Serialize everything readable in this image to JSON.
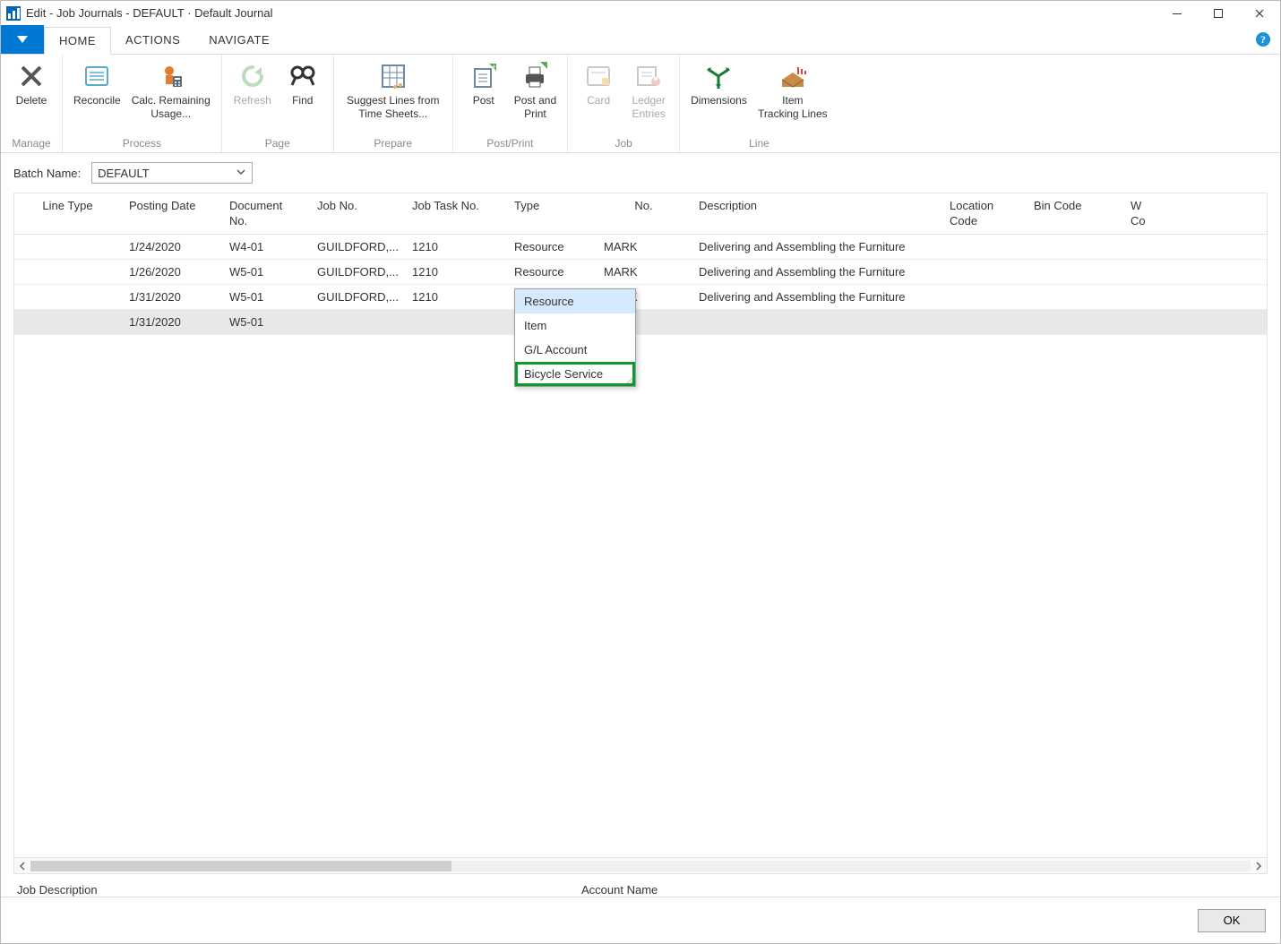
{
  "window": {
    "title": "Edit - Job Journals - DEFAULT · Default Journal"
  },
  "tabs": {
    "home": "HOME",
    "actions": "ACTIONS",
    "navigate": "NAVIGATE"
  },
  "ribbon": {
    "groups": {
      "manage": {
        "label": "Manage",
        "delete": "Delete"
      },
      "process": {
        "label": "Process",
        "reconcile": "Reconcile",
        "calc": "Calc. Remaining\nUsage..."
      },
      "page": {
        "label": "Page",
        "refresh": "Refresh",
        "find": "Find"
      },
      "prepare": {
        "label": "Prepare",
        "suggest": "Suggest Lines from\nTime Sheets..."
      },
      "postprint": {
        "label": "Post/Print",
        "post": "Post",
        "postandprint": "Post and\nPrint"
      },
      "job": {
        "label": "Job",
        "card": "Card",
        "ledger": "Ledger\nEntries"
      },
      "line": {
        "label": "Line",
        "dimensions": "Dimensions",
        "itemtracking": "Item\nTracking Lines"
      }
    }
  },
  "batch": {
    "label": "Batch Name:",
    "value": "DEFAULT"
  },
  "columns": {
    "linetype": "Line Type",
    "postingdate": "Posting Date",
    "docno": "Document\nNo.",
    "jobno": "Job No.",
    "jobtaskno": "Job Task No.",
    "type": "Type",
    "no": "No.",
    "description": "Description",
    "locationcode": "Location\nCode",
    "bincode": "Bin Code",
    "last": "W\nCo"
  },
  "rows": [
    {
      "postingdate": "1/24/2020",
      "docno": "W4-01",
      "jobno": "GUILDFORD,...",
      "jobtaskno": "1210",
      "type": "Resource",
      "no": "MARK",
      "description": "Delivering and Assembling the Furniture"
    },
    {
      "postingdate": "1/26/2020",
      "docno": "W5-01",
      "jobno": "GUILDFORD,...",
      "jobtaskno": "1210",
      "type": "Resource",
      "no": "MARK",
      "description": "Delivering and Assembling the Furniture"
    },
    {
      "postingdate": "1/31/2020",
      "docno": "W5-01",
      "jobno": "GUILDFORD,...",
      "jobtaskno": "1210",
      "type": "Resource",
      "no": "MARK",
      "description": "Delivering and Assembling the Furniture"
    },
    {
      "postingdate": "1/31/2020",
      "docno": "W5-01",
      "jobno": "",
      "jobtaskno": "",
      "type": "Resource",
      "no": "",
      "description": ""
    }
  ],
  "dropdown": {
    "options": [
      "Resource",
      "Item",
      "G/L Account",
      "Bicycle Service"
    ]
  },
  "status": {
    "jobdesc": "Job Description",
    "accountname": "Account Name"
  },
  "footer": {
    "ok": "OK"
  }
}
